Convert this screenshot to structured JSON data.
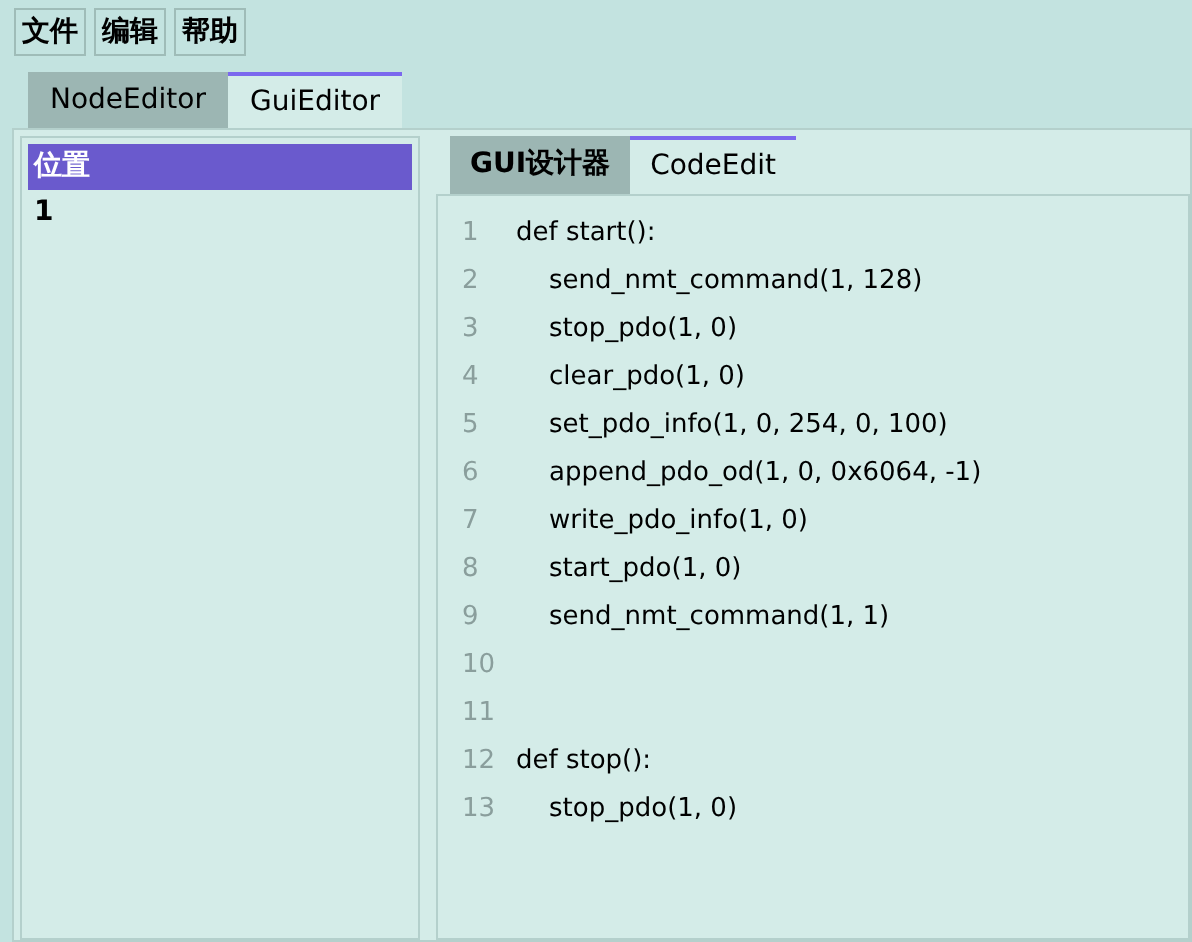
{
  "menu": [
    {
      "label": "文件"
    },
    {
      "label": "编辑"
    },
    {
      "label": "帮助"
    }
  ],
  "tabs": [
    {
      "label": "NodeEditor",
      "selected": false
    },
    {
      "label": "GuiEditor",
      "selected": true
    }
  ],
  "list": {
    "items": [
      {
        "label": "位置",
        "selected": true
      },
      {
        "label": "1",
        "selected": false
      }
    ]
  },
  "editor_tabs": [
    {
      "label": "GUI设计器",
      "selected": false
    },
    {
      "label": "CodeEdit",
      "selected": true
    }
  ],
  "code_lines": [
    {
      "number": "1",
      "code": "def start():"
    },
    {
      "number": "2",
      "code": "    send_nmt_command(1, 128)"
    },
    {
      "number": "3",
      "code": "    stop_pdo(1, 0)"
    },
    {
      "number": "4",
      "code": "    clear_pdo(1, 0)"
    },
    {
      "number": "5",
      "code": "    set_pdo_info(1, 0, 254, 0, 100)"
    },
    {
      "number": "6",
      "code": "    append_pdo_od(1, 0, 0x6064, -1)"
    },
    {
      "number": "7",
      "code": "    write_pdo_info(1, 0)"
    },
    {
      "number": "8",
      "code": "    start_pdo(1, 0)"
    },
    {
      "number": "9",
      "code": "    send_nmt_command(1, 1)"
    },
    {
      "number": "10"
    },
    {
      "number": "11"
    },
    {
      "number": "12",
      "code": "def stop():"
    },
    {
      "number": "13",
      "code": "    stop_pdo(1, 0)"
    }
  ]
}
